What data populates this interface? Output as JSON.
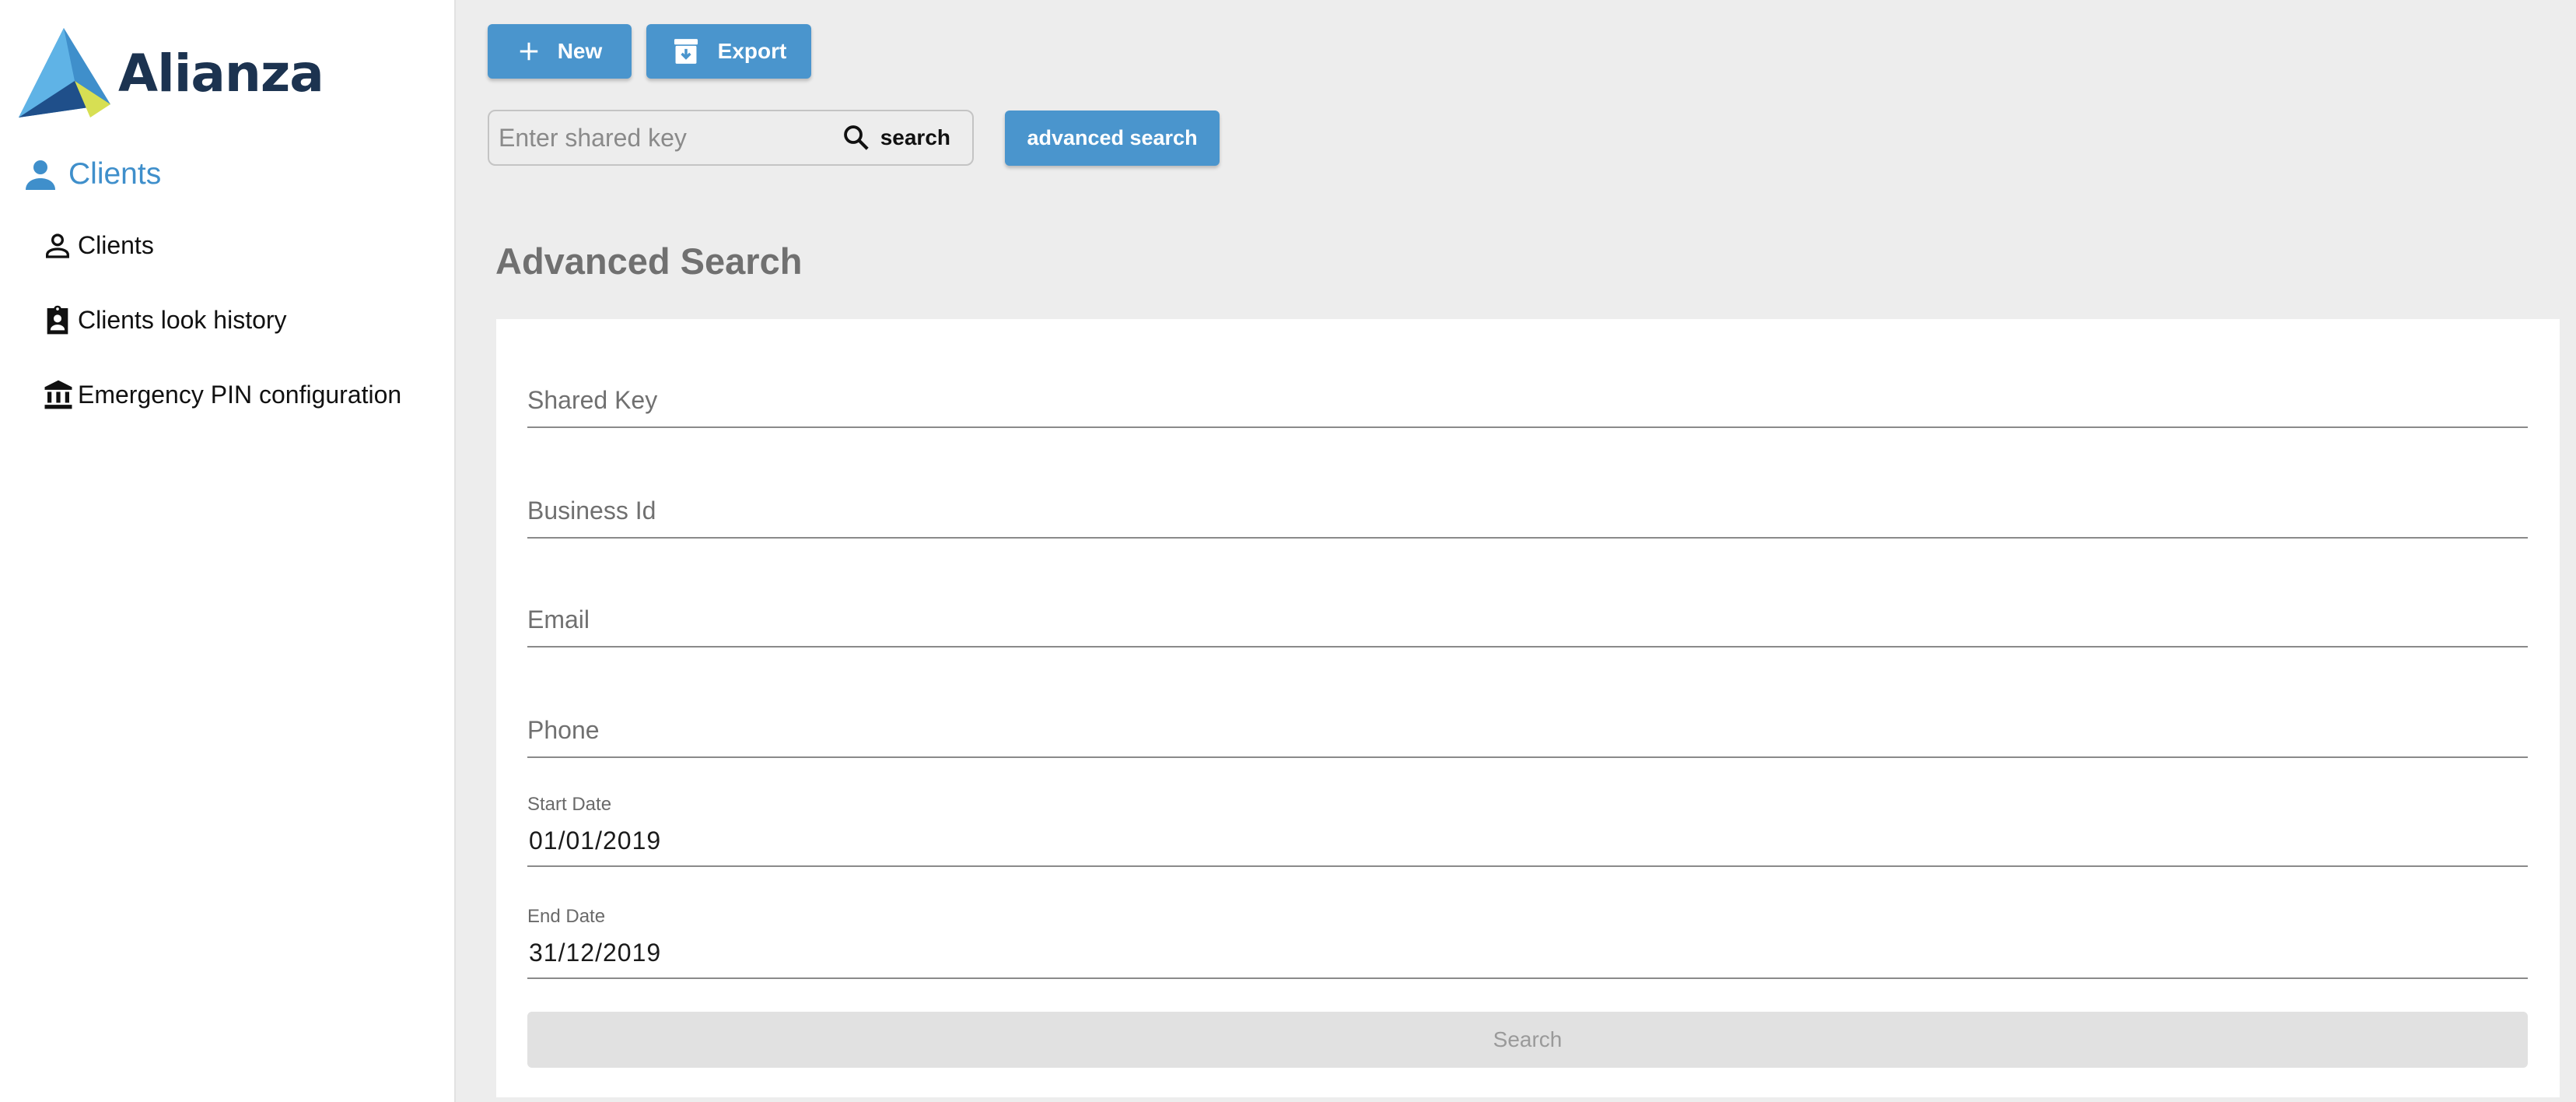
{
  "app": {
    "brand": "Alianza",
    "accent_color": "#4a95cd",
    "brand_color": "#1c3350"
  },
  "sidebar": {
    "section": {
      "label": "Clients",
      "icon": "person-filled-icon"
    },
    "items": [
      {
        "label": "Clients",
        "icon": "person-outline-icon"
      },
      {
        "label": "Clients look history",
        "icon": "badge-icon"
      },
      {
        "label": "Emergency PIN configuration",
        "icon": "bank-icon"
      }
    ]
  },
  "toolbar": {
    "new_label": "New",
    "export_label": "Export"
  },
  "search": {
    "placeholder": "Enter shared key",
    "value": "",
    "button_label": "search",
    "advanced_label": "advanced search"
  },
  "advanced": {
    "title": "Advanced Search",
    "fields": {
      "shared_key": {
        "placeholder": "Shared Key",
        "value": ""
      },
      "business_id": {
        "placeholder": "Business Id",
        "value": ""
      },
      "email": {
        "placeholder": "Email",
        "value": ""
      },
      "phone": {
        "placeholder": "Phone",
        "value": ""
      },
      "start_date": {
        "label": "Start Date",
        "value": "01/01/2019"
      },
      "end_date": {
        "label": "End Date",
        "value": "31/12/2019"
      }
    },
    "submit_label": "Search"
  }
}
